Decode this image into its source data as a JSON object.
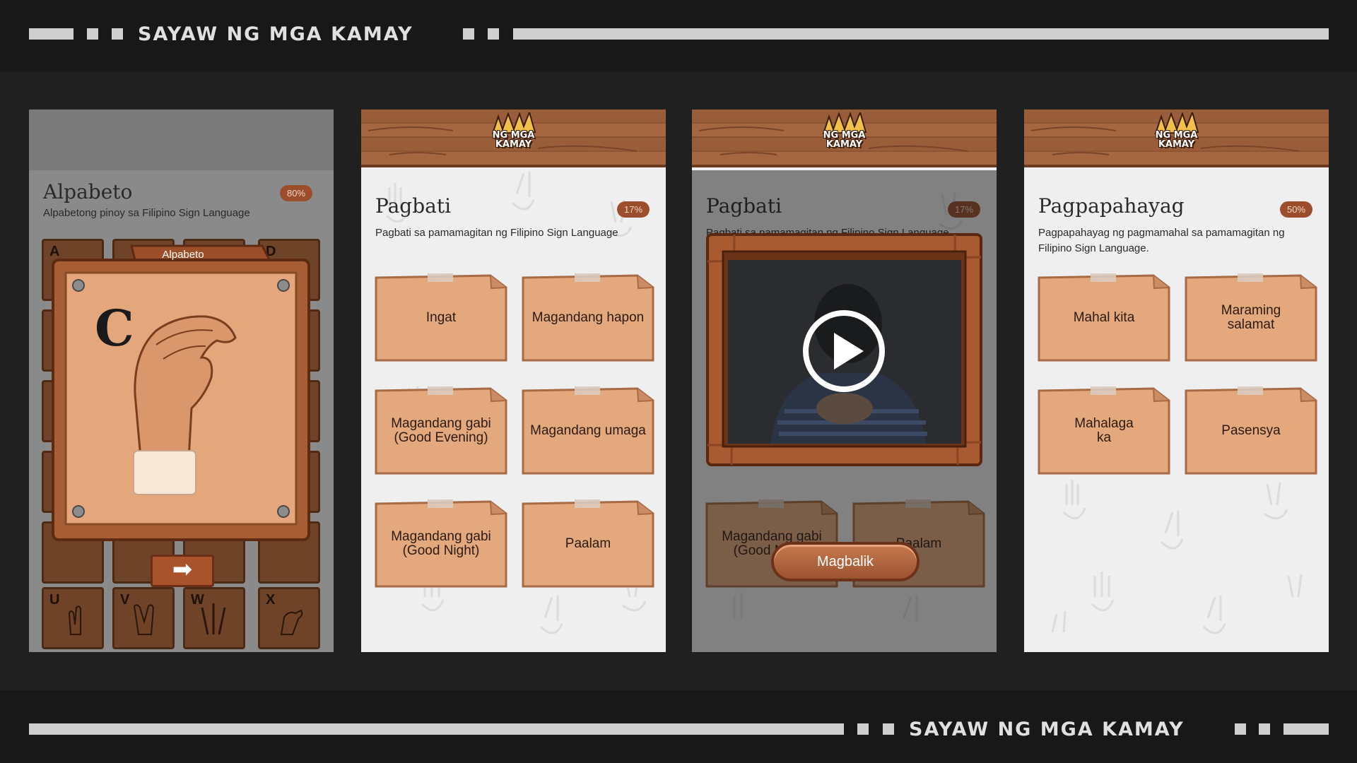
{
  "brand": {
    "name": "SAYAW NG MGA KAMAY"
  },
  "logo": {
    "line1": "NG MGA",
    "line2": "KAMAY"
  },
  "screen1": {
    "title": "Alpabeto",
    "subtitle": "Alpabetong pinoy sa Filipino Sign Language",
    "progress": "80%",
    "popup_tab": "Alpabeto",
    "letter": "C",
    "next_icon": "arrow-right-icon",
    "tiles": [
      "A",
      "D",
      "U",
      "V",
      "W",
      "X"
    ]
  },
  "screen2": {
    "title": "Pagbati",
    "subtitle": "Pagbati sa pamamagitan ng Filipino Sign Language",
    "progress": "17%",
    "cards": [
      "Ingat",
      "Magandang hapon",
      "Magandang gabi (Good Evening)",
      "Magandang umaga",
      "Magandang gabi (Good Night)",
      "Paalam"
    ]
  },
  "screen3": {
    "title": "Pagbati",
    "subtitle": "Pagbati sa pamamagitan ng Filipino Sign Language",
    "progress": "17%",
    "cards": [
      "Magandang gabi (Good Night)",
      "Paalam"
    ],
    "back_label": "Magbalik",
    "play_icon": "play-icon"
  },
  "screen4": {
    "title": "Pagpapahayag",
    "subtitle": "Pagpapahayag ng pagmamahal sa pamamagitan ng Filipino Sign Language.",
    "progress": "50%",
    "cards": [
      "Mahal kita",
      "Maraming salamat",
      "Mahalaga ka",
      "Pasensya"
    ]
  },
  "colors": {
    "wood": "#9a5d3a",
    "card": "#e3a87c",
    "badge": "#9c4e2c",
    "frame": "#181818"
  }
}
